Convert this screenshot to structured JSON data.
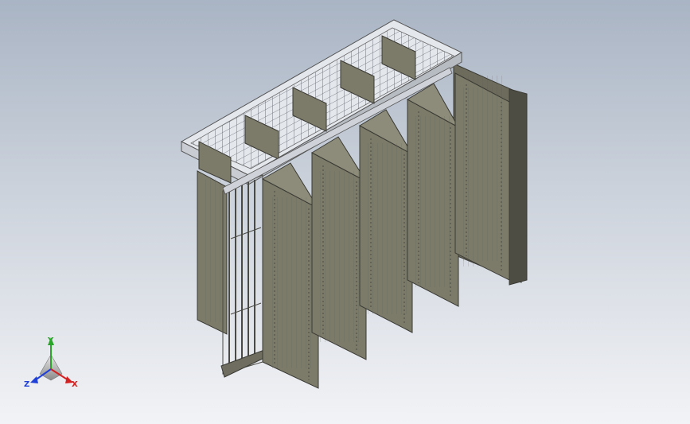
{
  "viewport": {
    "background_top": "#a9b4c4",
    "background_bottom": "#f2f3f6"
  },
  "model": {
    "panel_count": 5,
    "panel_face_color": "#7c7b6a",
    "panel_dark_color": "#55554a",
    "panel_edge_color": "#3a3a34",
    "frame_color": "#d9dde3",
    "mesh_color": "#5b6068"
  },
  "triad": {
    "x_label": "X",
    "y_label": "Y",
    "z_label": "Z",
    "x_color": "#d42020",
    "y_color": "#2aa52a",
    "z_color": "#2040d8"
  }
}
